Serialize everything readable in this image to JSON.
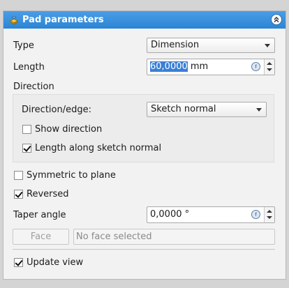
{
  "panel": {
    "title": "Pad parameters",
    "icon": "pad-icon",
    "collapse_icon": "collapse-icon"
  },
  "type": {
    "label": "Type",
    "value": "Dimension"
  },
  "length": {
    "label": "Length",
    "number": "60,0000",
    "unit": " mm"
  },
  "direction": {
    "label": "Direction",
    "edge_label": "Direction/edge:",
    "edge_value": "Sketch normal",
    "show_direction": {
      "label": "Show direction",
      "checked": false
    },
    "along_normal": {
      "label": "Length along sketch normal",
      "checked": true
    }
  },
  "symmetric": {
    "label": "Symmetric to plane",
    "checked": false
  },
  "reversed": {
    "label": "Reversed",
    "checked": true
  },
  "taper": {
    "label": "Taper angle",
    "value": "0,0000 °"
  },
  "face": {
    "button_label": "Face",
    "field_text": "No face selected"
  },
  "update_view": {
    "label": "Update view",
    "checked": true
  },
  "colors": {
    "title_bar": "#2b84d4",
    "selection": "#3a7fd6",
    "panel_bg": "#f2f2f2"
  }
}
